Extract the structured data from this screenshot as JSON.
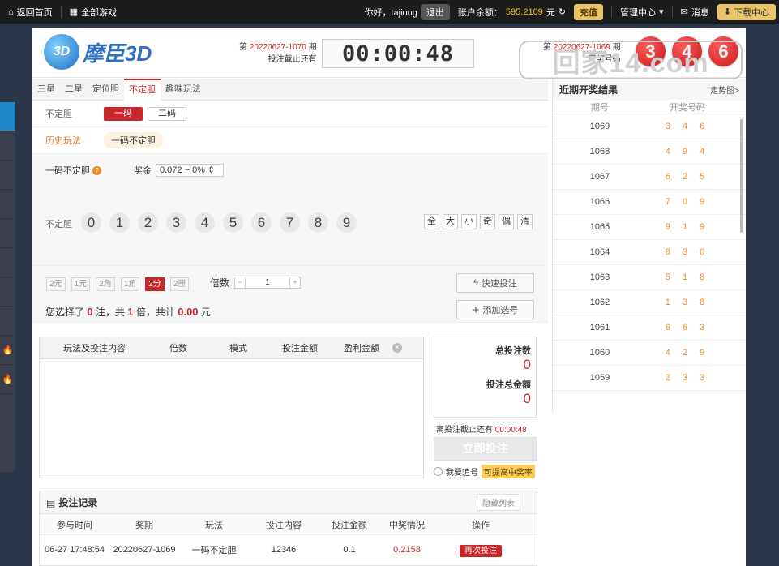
{
  "topbar": {
    "home": "返回首页",
    "all_games": "全部游戏",
    "greeting": "你好，tajiong",
    "logout": "退出",
    "balance_label": "账户余额：",
    "balance": "595.2109",
    "currency": "元",
    "recharge": "充值",
    "manage": "管理中心",
    "messages": "消息",
    "download": "下载中心"
  },
  "game": {
    "logo_badge": "3D",
    "logo_name": "摩臣3D",
    "issue_prefix": "第",
    "current_issue": "20220627-1070",
    "issue_suffix": "期",
    "deadline_label": "投注截止还有",
    "countdown": "00:00:48",
    "last_issue": "20220627-1069",
    "last_label": "开奖号码",
    "last_balls": [
      "3",
      "4",
      "6"
    ]
  },
  "watermark": "回家14.com",
  "tabs": [
    "三星",
    "二星",
    "定位胆",
    "不定胆",
    "趣味玩法"
  ],
  "active_tab": "不定胆",
  "play": {
    "label1": "不定胆",
    "options": [
      "一码",
      "二码"
    ],
    "selected": "一码",
    "label2": "历史玩法",
    "history": "一码不定胆"
  },
  "picker": {
    "name": "一码不定胆",
    "help": "?",
    "prize_label": "奖金",
    "prize_value": "0.072 ~ 0%",
    "row_label": "不定胆",
    "digits": [
      "0",
      "1",
      "2",
      "3",
      "4",
      "5",
      "6",
      "7",
      "8",
      "9"
    ],
    "filters": [
      "全",
      "大",
      "小",
      "奇",
      "偶",
      "清"
    ]
  },
  "bet": {
    "units": [
      "2元",
      "1元",
      "2角",
      "1角",
      "2分",
      "2厘"
    ],
    "unit_selected": "2分",
    "multiplier_label": "倍数",
    "multiplier": "1",
    "quick": "快速投注",
    "add": "添加选号",
    "sum_prefix": "您选择了",
    "notes": "0",
    "sum_notes_unit": "注，共",
    "times": "1",
    "sum_times_unit": "倍，共计",
    "amount": "0.00",
    "sum_currency": "元"
  },
  "list": {
    "cols": [
      "玩法及投注内容",
      "倍数",
      "模式",
      "投注金额",
      "盈利金额"
    ]
  },
  "totals": {
    "count_label": "总投注数",
    "count": "0",
    "amount_label": "投注总金额",
    "amount": "0",
    "deadline": "离投注截止还有",
    "deadline_time": "00:00:48",
    "submit": "立即投注",
    "chase": "我要追号",
    "chase_tag": "可提高中奖率"
  },
  "records": {
    "title": "投注记录",
    "hide": "隐藏列表",
    "cols": [
      "参与时间",
      "奖期",
      "玩法",
      "投注内容",
      "投注金额",
      "中奖情况",
      "操作"
    ],
    "rows": [
      {
        "time": "06-27 17:48:54",
        "issue": "20220627-1069",
        "play": "一码不定胆",
        "content": "12346",
        "amount": "0.1",
        "win": "0.2158",
        "action": "再次投注"
      }
    ]
  },
  "recent": {
    "title": "近期开奖结果",
    "trend": "走势图>",
    "col_issue": "期号",
    "col_nums": "开奖号码",
    "rows": [
      {
        "p": "1069",
        "n": "3 4 6"
      },
      {
        "p": "1068",
        "n": "4 9 4"
      },
      {
        "p": "1067",
        "n": "6 2 5"
      },
      {
        "p": "1066",
        "n": "7 0 9"
      },
      {
        "p": "1065",
        "n": "9 1 9"
      },
      {
        "p": "1064",
        "n": "8 3 0"
      },
      {
        "p": "1063",
        "n": "5 1 8"
      },
      {
        "p": "1062",
        "n": "1 3 8"
      },
      {
        "p": "1061",
        "n": "6 6 3"
      },
      {
        "p": "1060",
        "n": "4 2 9"
      },
      {
        "p": "1059",
        "n": "2 3 3"
      }
    ]
  }
}
